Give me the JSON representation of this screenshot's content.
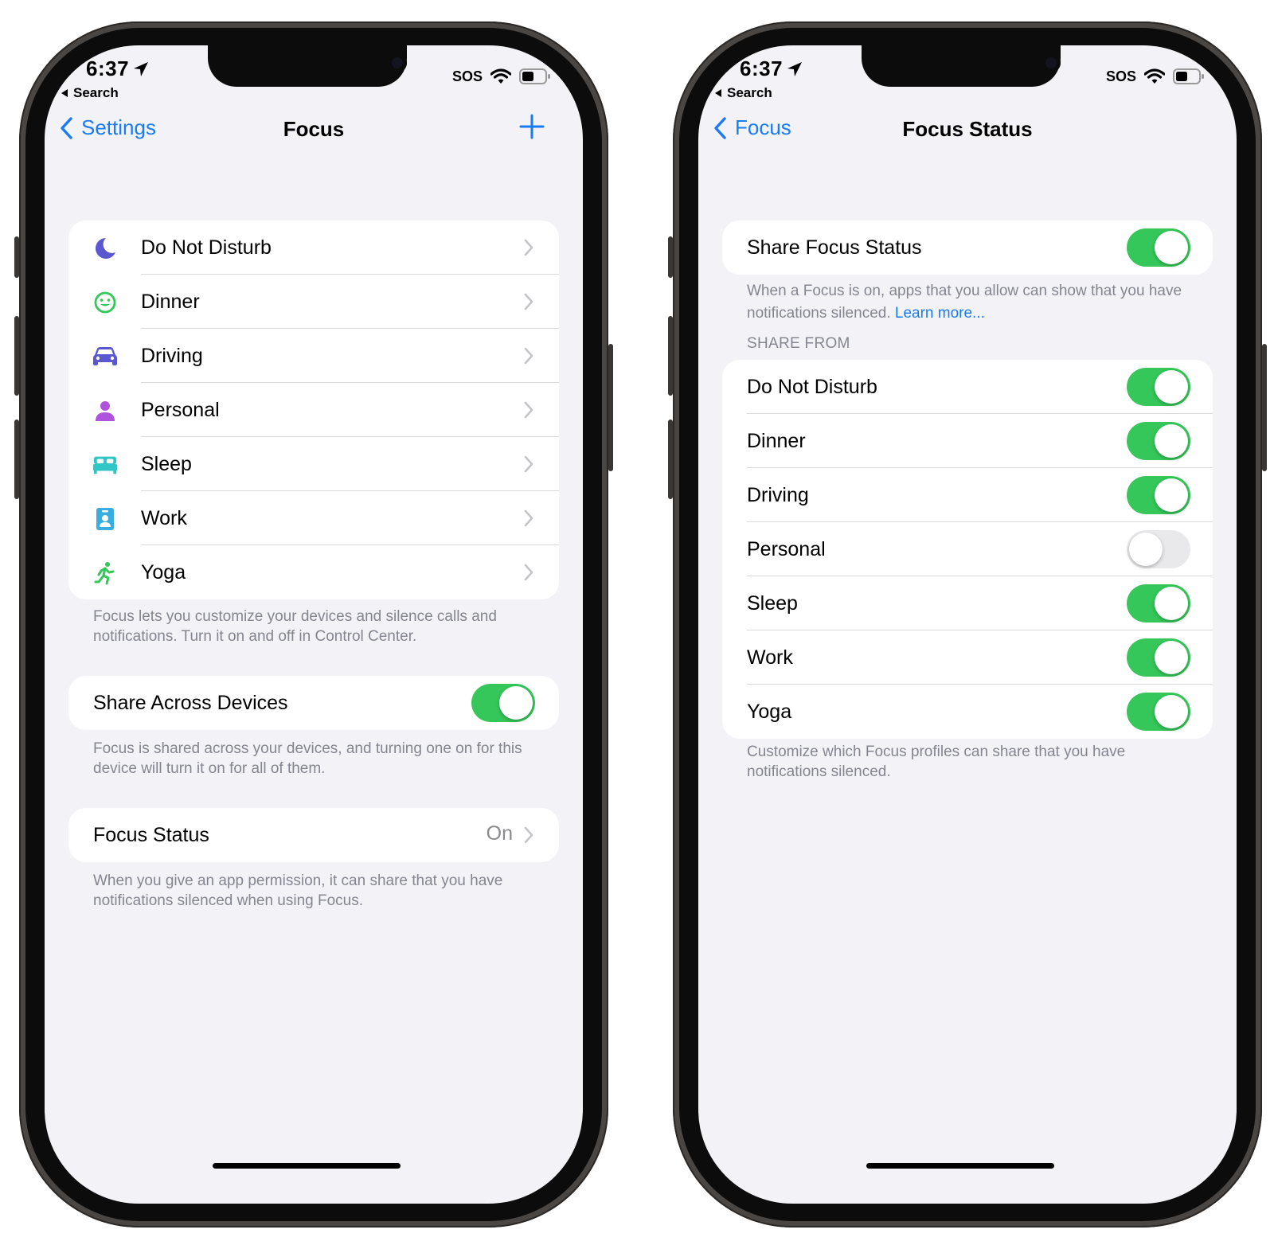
{
  "left_phone": {
    "status_bar": {
      "time": "6:37",
      "back_app": "Search",
      "carrier": "SOS"
    },
    "nav": {
      "back_label": "Settings",
      "title": "Focus"
    },
    "focus_modes": [
      {
        "label": "Do Not Disturb",
        "icon": "moon-icon",
        "color": "#5b57d0"
      },
      {
        "label": "Dinner",
        "icon": "smiley-icon",
        "color": "#34c759"
      },
      {
        "label": "Driving",
        "icon": "car-icon",
        "color": "#5b57d0"
      },
      {
        "label": "Personal",
        "icon": "person-icon",
        "color": "#af52de"
      },
      {
        "label": "Sleep",
        "icon": "bed-icon",
        "color": "#30c6c6"
      },
      {
        "label": "Work",
        "icon": "badge-icon",
        "color": "#38aee0"
      },
      {
        "label": "Yoga",
        "icon": "running-figure-icon",
        "color": "#34c759"
      }
    ],
    "focus_footer": "Focus lets you customize your devices and silence calls and notifications. Turn it on and off in Control Center.",
    "share_across": {
      "label": "Share Across Devices",
      "on": true
    },
    "share_footer": "Focus is shared across your devices, and turning one on for this device will turn it on for all of them.",
    "focus_status": {
      "label": "Focus Status",
      "value": "On"
    },
    "status_footer": "When you give an app permission, it can share that you have notifications silenced when using Focus."
  },
  "right_phone": {
    "status_bar": {
      "time": "6:37",
      "back_app": "Search",
      "carrier": "SOS"
    },
    "nav": {
      "back_label": "Focus",
      "title": "Focus Status"
    },
    "share_focus_status": {
      "label": "Share Focus Status",
      "on": true
    },
    "share_footer": "When a Focus is on, apps that you allow can show that you have notifications silenced.",
    "learn_more": "Learn more...",
    "section_header": "SHARE FROM",
    "share_from": [
      {
        "label": "Do Not Disturb",
        "on": true
      },
      {
        "label": "Dinner",
        "on": true
      },
      {
        "label": "Driving",
        "on": true
      },
      {
        "label": "Personal",
        "on": false
      },
      {
        "label": "Sleep",
        "on": true
      },
      {
        "label": "Work",
        "on": true
      },
      {
        "label": "Yoga",
        "on": true
      }
    ],
    "share_from_footer": "Customize which Focus profiles can share that you have notifications silenced."
  },
  "colors": {
    "accent": "#1a7cf2",
    "toggle_on": "#35c759",
    "toggle_off": "#e9e9eb",
    "background": "#f2f2f7"
  }
}
